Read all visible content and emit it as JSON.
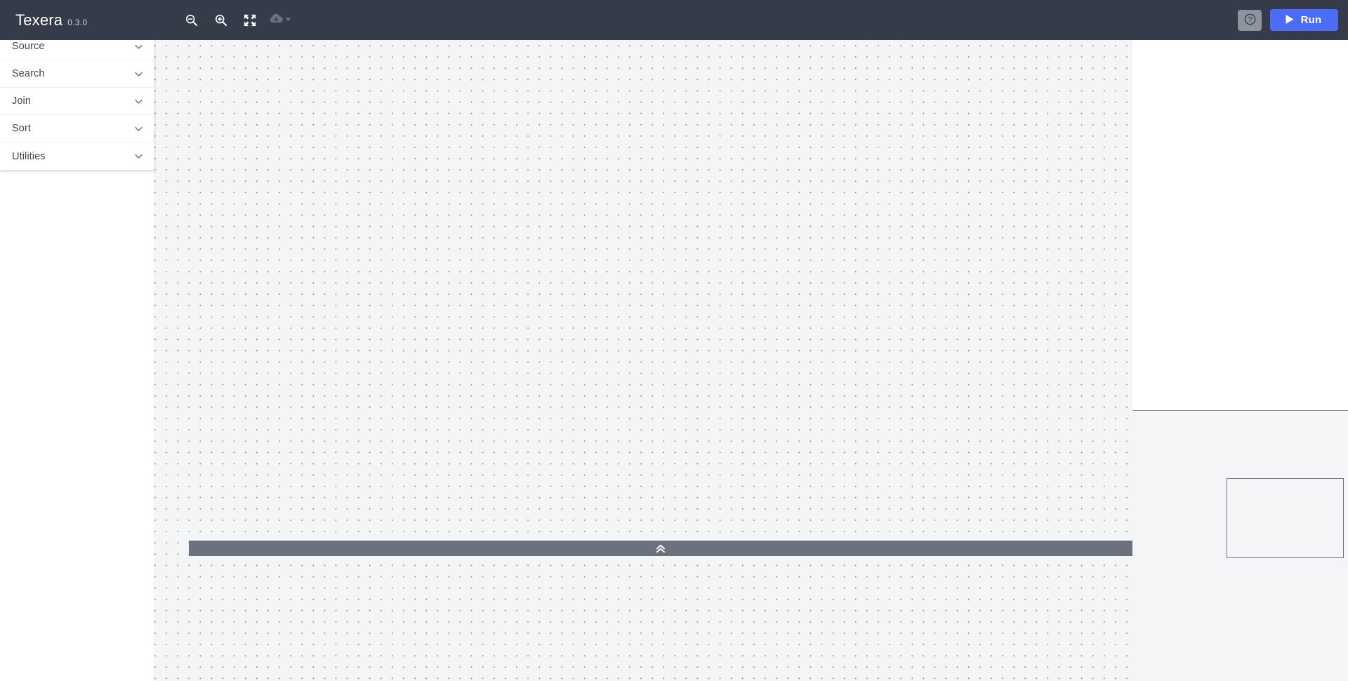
{
  "header": {
    "brand_name": "Texera",
    "version": "0.3.0",
    "toolbar": [
      {
        "name": "zoom-out-button",
        "icon": "magnifier-minus-icon",
        "title": "Zoom Out"
      },
      {
        "name": "zoom-in-button",
        "icon": "magnifier-plus-icon",
        "title": "Zoom In"
      },
      {
        "name": "fit-to-screen-button",
        "icon": "expand-arrows-icon",
        "title": "Fit to Screen"
      },
      {
        "name": "save-workflow-button",
        "icon": "cloud-download-icon",
        "title": "Save Workflow"
      }
    ],
    "help_label": "?",
    "help_title": "Help",
    "run_label": "Run",
    "run_icon": "play-icon"
  },
  "sidebar": {
    "items": [
      {
        "label": "Source",
        "icon": "chevron-down-icon"
      },
      {
        "label": "Search",
        "icon": "chevron-down-icon"
      },
      {
        "label": "Join",
        "icon": "chevron-down-icon"
      },
      {
        "label": "Sort",
        "icon": "chevron-down-icon"
      },
      {
        "label": "Utilities",
        "icon": "chevron-down-icon"
      }
    ]
  },
  "canvas": {
    "grid": "dot-grid",
    "background_color": "#f4f5f6",
    "dot_color": "#8f949c",
    "operators": []
  },
  "bottom_bar": {
    "expand_icon": "double-chevron-up-icon",
    "background_color": "#6b727e"
  },
  "minimap": {
    "background_color": "#f4f5f6",
    "viewport_border_color": "#70767f"
  },
  "colors": {
    "header_background": "#353b48",
    "accent_run": "#4a6cf7",
    "help_button": "#8d949e"
  }
}
